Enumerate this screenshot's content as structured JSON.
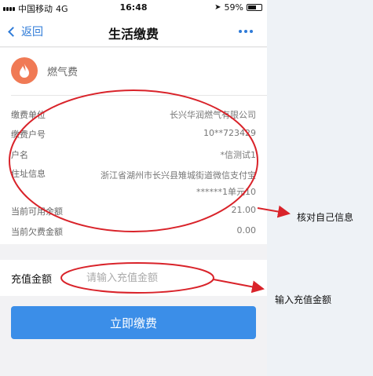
{
  "status_bar": {
    "carrier": "中国移动",
    "network": "4G",
    "time": "16:48",
    "battery": "59%"
  },
  "nav": {
    "back_label": "返回",
    "title": "生活缴费"
  },
  "provider": {
    "name": "燃气费"
  },
  "details": [
    {
      "label": "缴费单位",
      "value": "长兴华润燃气有限公司"
    },
    {
      "label": "缴费户号",
      "value": "10**723429"
    },
    {
      "label": "户名",
      "value": "*信测试1"
    },
    {
      "label": "住址信息",
      "value": "浙江省湖州市长兴县雉城街道微信支付宝******1单元10"
    },
    {
      "label": "当前可用余额",
      "value": "21.00"
    },
    {
      "label": "当前欠费金额",
      "value": "0.00"
    }
  ],
  "recharge": {
    "label": "充值金额",
    "placeholder": "请输入充值金额"
  },
  "pay_button": "立即缴费",
  "annotations": {
    "verify_info": "核对自己信息",
    "enter_amount": "输入充值金额"
  },
  "colors": {
    "accent": "#3b8ee8",
    "annotation": "#d9232a",
    "gas_icon": "#f07a55"
  }
}
